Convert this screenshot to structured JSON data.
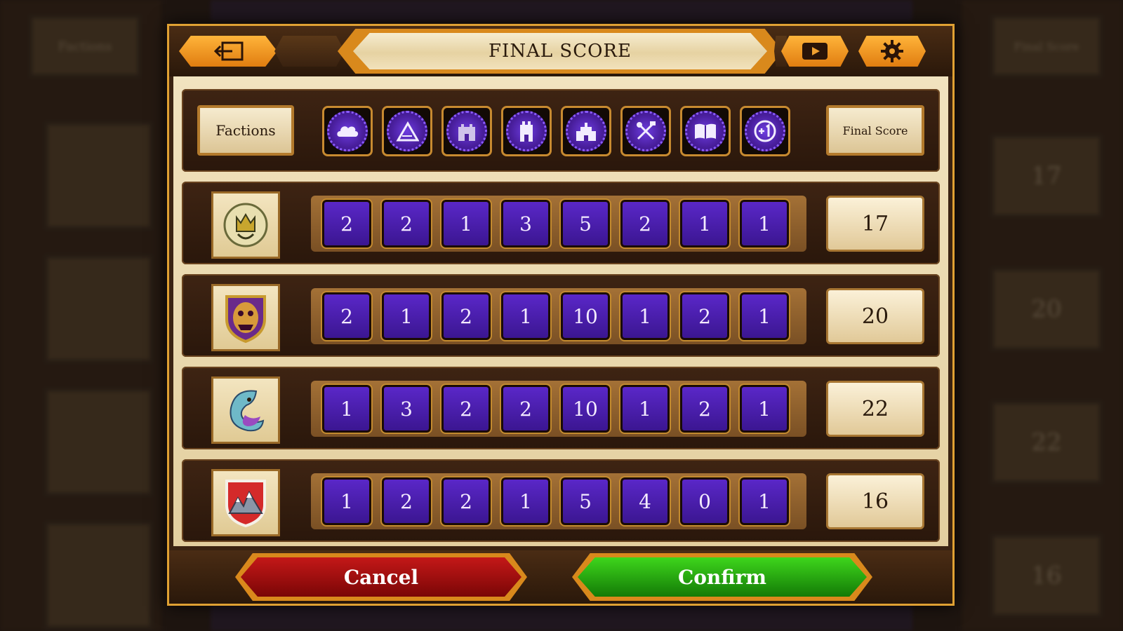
{
  "dialog": {
    "title": "FINAL SCORE",
    "cancel_label": "Cancel",
    "confirm_label": "Confirm"
  },
  "header": {
    "factions_label": "Factions",
    "final_score_label": "Final Score",
    "categories": [
      {
        "icon": "cloud-icon"
      },
      {
        "icon": "hill-icon"
      },
      {
        "icon": "castle-icon"
      },
      {
        "icon": "tower-icon"
      },
      {
        "icon": "city-icon"
      },
      {
        "icon": "crossed-tools-icon"
      },
      {
        "icon": "book-icon"
      },
      {
        "icon": "plus-one-icon"
      }
    ]
  },
  "rows": [
    {
      "faction_icon": "crown-shield-icon",
      "scores": [
        "2",
        "2",
        "1",
        "3",
        "5",
        "2",
        "1",
        "1"
      ],
      "final": "17"
    },
    {
      "faction_icon": "demon-mask-shield-icon",
      "scores": [
        "2",
        "1",
        "2",
        "1",
        "10",
        "1",
        "2",
        "1"
      ],
      "final": "20"
    },
    {
      "faction_icon": "dragon-shield-icon",
      "scores": [
        "1",
        "3",
        "2",
        "2",
        "10",
        "1",
        "2",
        "1"
      ],
      "final": "22"
    },
    {
      "faction_icon": "mountain-shield-icon",
      "scores": [
        "1",
        "2",
        "2",
        "1",
        "5",
        "4",
        "0",
        "1"
      ],
      "final": "16"
    }
  ],
  "background": {
    "left_label": "Factions",
    "right_label": "Final Score",
    "right_scores": [
      "17",
      "20",
      "22",
      "16"
    ]
  }
}
